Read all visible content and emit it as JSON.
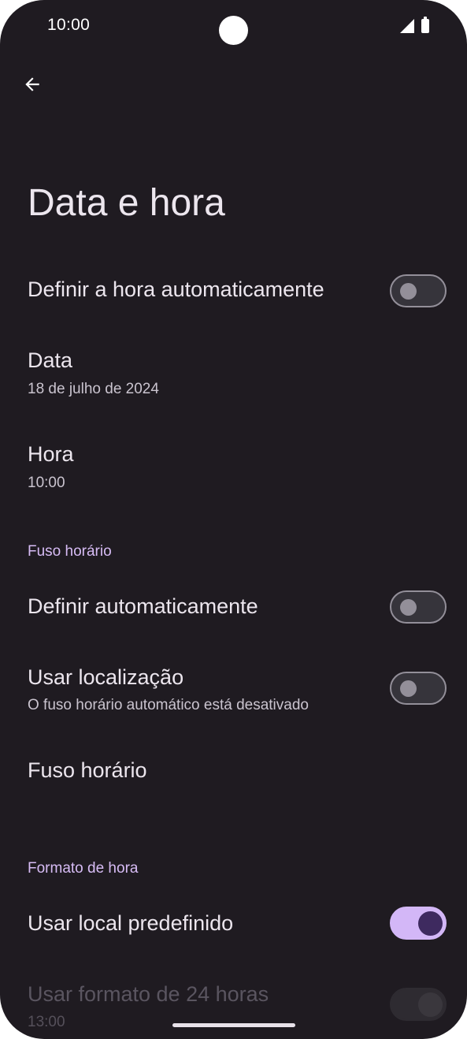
{
  "status_bar": {
    "time": "10:00",
    "icons": [
      "signal-icon",
      "battery-icon"
    ]
  },
  "nav": {
    "back_icon": "arrow-back-icon"
  },
  "page_title": "Data e hora",
  "settings": {
    "auto_time": {
      "label": "Definir a hora automaticamente",
      "enabled": false
    },
    "date": {
      "label": "Data",
      "value": "18 de julho de 2024"
    },
    "time": {
      "label": "Hora",
      "value": "10:00"
    }
  },
  "timezone_section": {
    "header": "Fuso horário",
    "auto": {
      "label": "Definir automaticamente",
      "enabled": false
    },
    "use_location": {
      "label": "Usar localização",
      "sub": "O fuso horário automático está desativado",
      "enabled": false
    },
    "timezone": {
      "label": "Fuso horário"
    }
  },
  "time_format_section": {
    "header": "Formato de hora",
    "use_locale": {
      "label": "Usar local predefinido",
      "enabled": true
    },
    "use_24h": {
      "label": "Usar formato de 24 horas",
      "sub": "13:00",
      "enabled": true,
      "disabled": true
    }
  },
  "colors": {
    "background": "#1f1b21",
    "accent": "#d3b7f7",
    "section_header": "#d7bcf5"
  }
}
